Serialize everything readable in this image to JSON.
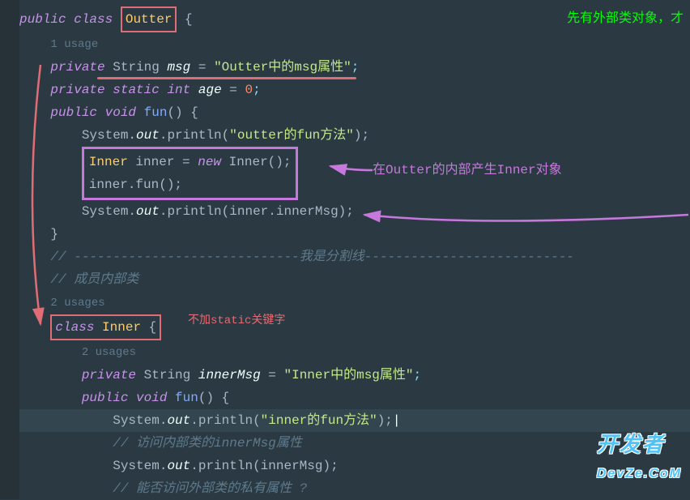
{
  "lines": {
    "l1_kw1": "public",
    "l1_kw2": "class",
    "l1_cls": "Outter",
    "l1_brace": " {",
    "l2_usage": "1 usage",
    "l3_kw": "private",
    "l3_type": "String",
    "l3_field": "msg",
    "l3_eq": " = ",
    "l3_str": "\"Outter中的msg属性\"",
    "l3_semi": ";",
    "l4_kw1": "private",
    "l4_kw2": "static",
    "l4_kw3": "int",
    "l4_field": "age",
    "l4_eq": " = ",
    "l4_num": "0",
    "l4_semi": ";",
    "l5_kw1": "public",
    "l5_kw2": "void",
    "l5_method": "fun",
    "l5_paren": "() {",
    "l6_sys": "System.",
    "l6_out": "out",
    "l6_p": ".println(",
    "l6_str": "\"outter的fun方法\"",
    "l6_end": ");",
    "l7_type": "Inner",
    "l7_var": " inner = ",
    "l7_new": "new",
    "l7_ctor": " Inner();",
    "l8_call": "inner.fun();",
    "l9_sys": "System.",
    "l9_out": "out",
    "l9_p": ".println(inner.innerMsg);",
    "l10_brace": "}",
    "l11_comment": "// -----------------------------我是分割线---------------------------",
    "l12_comment": "// 成员内部类",
    "l13_usage": "2 usages",
    "l14_kw": "class",
    "l14_cls": "Inner",
    "l14_brace": " {",
    "l15_usage": "2 usages",
    "l16_kw": "private",
    "l16_type": "String",
    "l16_field": "innerMsg",
    "l16_eq": " = ",
    "l16_str": "\"Inner中的msg属性\"",
    "l16_semi": ";",
    "l17_kw1": "public",
    "l17_kw2": "void",
    "l17_method": "fun",
    "l17_paren": "() {",
    "l18_sys": "System.",
    "l18_out": "out",
    "l18_p": ".println(",
    "l18_str": "\"inner的fun方法\"",
    "l18_end": ");",
    "l19_comment": "// 访问内部类的innerMsg属性",
    "l20_sys": "System.",
    "l20_out": "out",
    "l20_p": ".println(innerMsg);",
    "l21_comment": "// 能否访问外部类的私有属性 ?"
  },
  "annotations": {
    "green_top": "先有外部类对象，才",
    "magenta_text": "在Outter的内部产生Inner对象",
    "red_text": "不加static关键字"
  },
  "watermark": "开发者\nDevZe.CoM"
}
